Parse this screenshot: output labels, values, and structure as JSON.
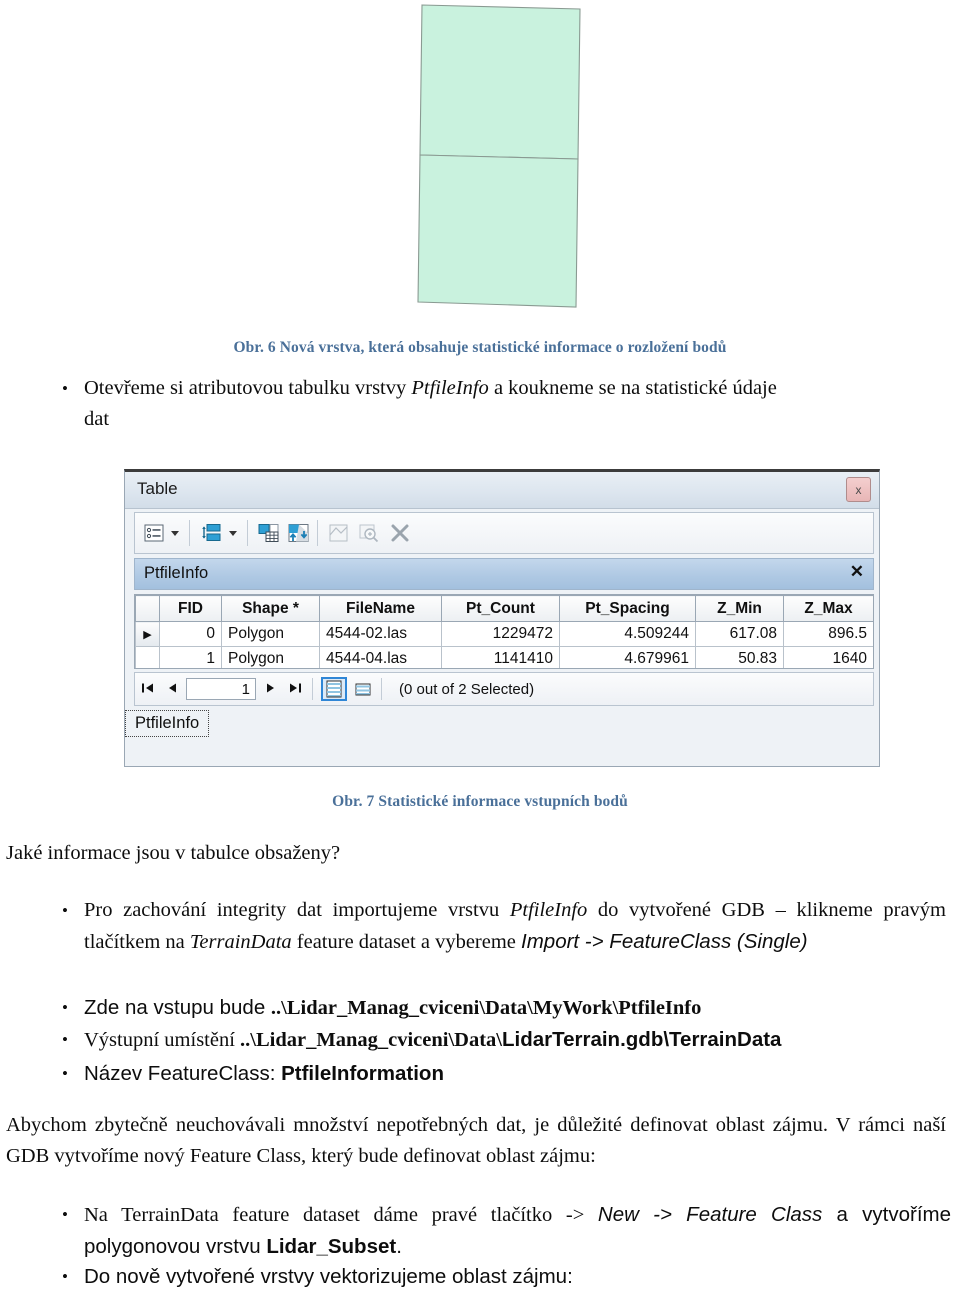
{
  "figure6": {
    "caption": "Obr. 6 Nová vrstva, která obsahuje statistické informace o rozložení bodů",
    "caption_color": "#4a7099",
    "polygon_fill": "#c9f2de",
    "polygon_stroke": "#8a9a92"
  },
  "bullet_open_table": {
    "marker": "•",
    "line1_a": "Otevřeme si atributovou tabulku vrstvy ",
    "line1_italic": "PtfileInfo",
    "line1_b": " a koukneme se na statistické údaje",
    "line2": "dat"
  },
  "table_window": {
    "title": "Table",
    "close_icon": "x",
    "toolbar_icons": [
      "table-options-icon",
      "options-dropdown-caret",
      "related-tables-icon",
      "related-tables-caret",
      "table-calculate-icon",
      "table-export-icon",
      "table-select-icon",
      "zoom-to-selected-icon",
      "clear-selection-icon"
    ],
    "tab_label": "PtfileInfo",
    "tab_close_icon": "✕",
    "columns": [
      "FID",
      "Shape *",
      "FileName",
      "Pt_Count",
      "Pt_Spacing",
      "Z_Min",
      "Z_Max"
    ],
    "rows": [
      {
        "pointer": "▶",
        "FID": "0",
        "Shape": "Polygon",
        "FileName": "4544-02.las",
        "Pt_Count": "1229472",
        "Pt_Spacing": "4.509244",
        "Z_Min": "617.08",
        "Z_Max": "896.5"
      },
      {
        "pointer": "",
        "FID": "1",
        "Shape": "Polygon",
        "FileName": "4544-04.las",
        "Pt_Count": "1141410",
        "Pt_Spacing": "4.679961",
        "Z_Min": "50.83",
        "Z_Max": "1640"
      }
    ],
    "record_nav": {
      "first": "⏮",
      "prev": "◀",
      "index": "1",
      "next": "▶",
      "last": "⏭",
      "view_table_icon": "table-view-icon",
      "view_selected_icon": "selected-view-icon",
      "status": "(0 out of 2 Selected)"
    },
    "bottom_tab": "PtfileInfo"
  },
  "figure7": {
    "caption": "Obr. 7 Statistické informace vstupních bodů"
  },
  "question_line": "Jaké informace jsou v tabulce obsaženy?",
  "bullet_import": {
    "marker": "•",
    "p1": "Pro zachování integrity dat importujeme vrstvu ",
    "p2_italic": "PtfileInfo",
    "p3": "  do vytvořené GDB – klikneme pravým tlačítkem na ",
    "p4_italic": "TerrainData",
    "p5": " feature dataset a vybereme ",
    "p6_sans_italic": "Import -> FeatureClass (Single)"
  },
  "bullet_input": {
    "marker": "•",
    "label": "Zde na vstupu bude ",
    "path": "..\\Lidar_Manag_cviceni\\Data\\MyWork\\PtfileInfo"
  },
  "bullet_output": {
    "marker": "•",
    "label": "Výstupní umístění ",
    "path_serif": "..\\Lidar_Manag_cviceni\\Data\\",
    "path_sans": "LidarTerrain.gdb\\TerrainData"
  },
  "bullet_fcname": {
    "marker": "•",
    "label": "Název FeatureClass: ",
    "value": "PtfileInformation"
  },
  "paragraph_area": "Abychom zbytečně neuchovávali množství nepotřebných dat, je důležité definovat oblast zájmu. V rámci naší GDB vytvoříme nový Feature Class, který bude definovat oblast zájmu:",
  "bullet_newfc": {
    "marker": "•",
    "p1": "Na TerrainData feature dataset dáme pravé tlačítko -> ",
    "p2_sans_italic": "New -> Feature Class",
    "p3": " a vytvoříme polygonovou vrstvu ",
    "p4_bold": "Lidar_Subset",
    "p5": "."
  },
  "bullet_vectorize": {
    "marker": "•",
    "text": "Do nově vytvořené vrstvy vektorizujeme oblast zájmu:"
  }
}
